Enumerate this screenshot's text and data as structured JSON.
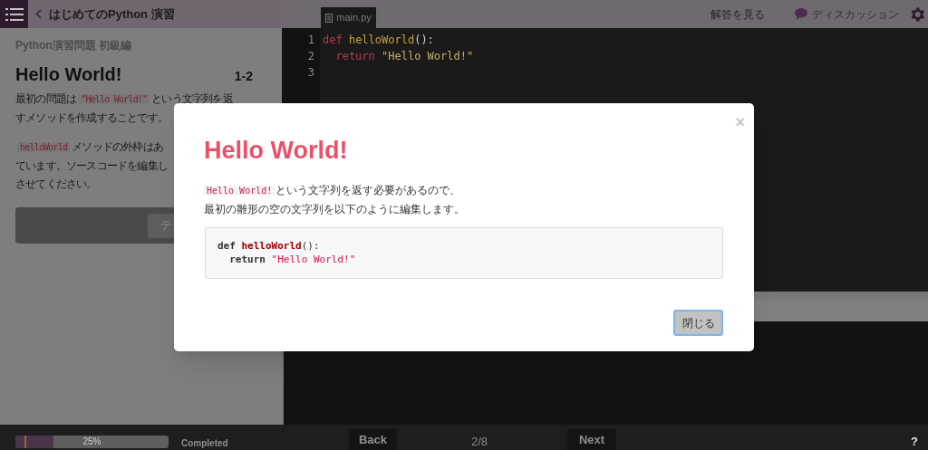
{
  "header": {
    "back_label": "はじめてのPython 演習"
  },
  "lesson": {
    "category": "Python演習問題 初級編",
    "title": "Hello World!",
    "number": "1-2",
    "paragraphs": [
      [
        [
          {
            "kind": "text",
            "text": "最初の問題は"
          },
          {
            "kind": "code",
            "text": "\"Hello World!\""
          },
          {
            "kind": "text",
            "text": "という文字列を返"
          }
        ],
        [
          {
            "kind": "text",
            "text": "すメソッドを作成することです。"
          }
        ]
      ],
      [
        [
          {
            "kind": "code",
            "text": "helloWorld"
          },
          {
            "kind": "text",
            "text": "メソッドの外枠はあ"
          }
        ],
        [
          {
            "kind": "text",
            "text": "ています。ソースコードを編集し"
          }
        ],
        [
          {
            "kind": "text",
            "text": "させてください。"
          }
        ]
      ]
    ],
    "run_button": "テ"
  },
  "editor": {
    "tab": "main.py",
    "lines": [
      {
        "number": "1",
        "tokens": [
          {
            "kind": "keyword",
            "text": "def"
          },
          {
            "kind": "function",
            "text": " helloWorld"
          },
          {
            "kind": "plain",
            "text": "():"
          }
        ]
      },
      {
        "number": "2",
        "tokens": [
          {
            "kind": "keyword",
            "text": "  return"
          },
          {
            "kind": "string",
            "text": " \"Hello World!\""
          }
        ]
      },
      {
        "number": "3"
      }
    ]
  },
  "toolbar": {
    "answer_link": "解答を見る",
    "discussion_link": "ディスカッション"
  },
  "modal": {
    "title": "Hello World!",
    "close": "×",
    "text_lines": [
      [
        {
          "kind": "code",
          "text": "Hello World!"
        },
        {
          "kind": "text",
          "text": "という文字列を返す必要があるので、"
        }
      ],
      [
        {
          "kind": "text",
          "text": "最初の雛形の空の文字列を以下のように編集します。"
        }
      ]
    ],
    "code_lines": [
      {
        "tokens": [
          {
            "kind": "keyword",
            "text": "def"
          },
          {
            "kind": "function",
            "text": " helloWorld"
          },
          {
            "kind": "plain",
            "text": "():"
          }
        ]
      },
      {
        "tokens": [
          {
            "kind": "keyword",
            "text": "  return"
          },
          {
            "kind": "string",
            "text": " \"Hello World!\""
          }
        ]
      }
    ],
    "button": "閉じる"
  },
  "footer": {
    "progress": {
      "level": 0.25,
      "label": "25%"
    },
    "status": "Completed",
    "back": "Back",
    "page": "2/8",
    "next": "Next",
    "help": "?"
  }
}
